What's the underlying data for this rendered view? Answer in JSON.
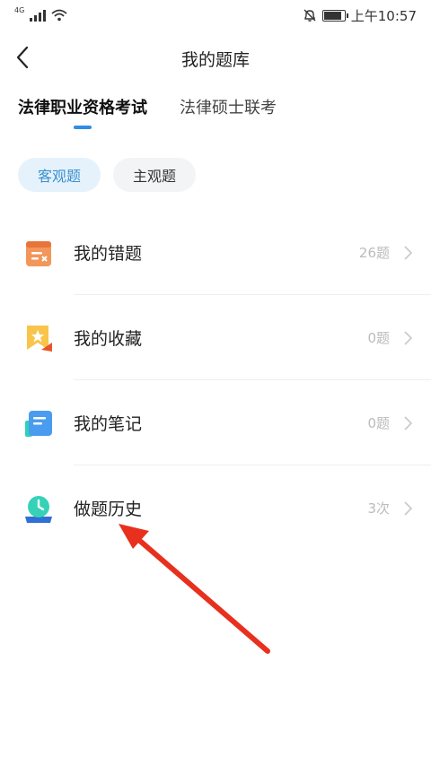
{
  "status_bar": {
    "network": "4G",
    "time": "上午10:57",
    "battery_level": 0.8
  },
  "header": {
    "title": "我的题库"
  },
  "tabs": [
    {
      "label": "法律职业资格考试",
      "active": true
    },
    {
      "label": "法律硕士联考",
      "active": false
    }
  ],
  "chips": [
    {
      "label": "客观题",
      "active": true
    },
    {
      "label": "主观题",
      "active": false
    }
  ],
  "list": [
    {
      "label": "我的错题",
      "value": "26题",
      "icon": "wrong-questions-icon"
    },
    {
      "label": "我的收藏",
      "value": "0题",
      "icon": "favorites-icon"
    },
    {
      "label": "我的笔记",
      "value": "0题",
      "icon": "notes-icon"
    },
    {
      "label": "做题历史",
      "value": "3次",
      "icon": "history-clock-icon"
    }
  ],
  "colors": {
    "accent": "#2f8de4",
    "chip_active_bg": "#e6f2fb",
    "annotation_arrow": "#e8301e"
  }
}
